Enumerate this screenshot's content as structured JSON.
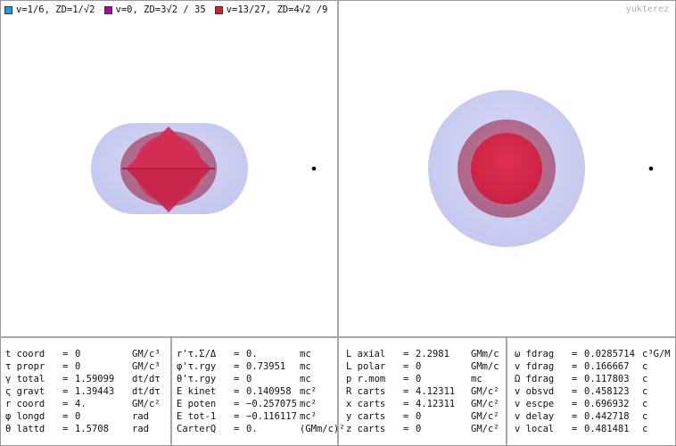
{
  "legend": [
    {
      "label": "v=1/6, ZD=1/√2",
      "color": "#1aa0e0"
    },
    {
      "label": "v=0, ZD=3√2 / 35",
      "color": "#b000b0"
    },
    {
      "label": "v=13/27, ZD=4√2 /9",
      "color": "#e01a2a"
    }
  ],
  "watermark": "yukterez",
  "colors": {
    "outer_shell": "#c9cbf2",
    "middle_shell": "#b96b8a",
    "core": "#d8284c",
    "separator": "#a8a8a8"
  },
  "panels": [
    {
      "rows": [
        {
          "name": "t coord",
          "eq": "=",
          "value": "0",
          "unit": "GM/c³"
        },
        {
          "name": "τ propr",
          "eq": "=",
          "value": "0",
          "unit": "GM/c³"
        },
        {
          "name": "γ total",
          "eq": "=",
          "value": "1.59099",
          "unit": "dt/dτ"
        },
        {
          "name": "ς gravt",
          "eq": "=",
          "value": "1.39443",
          "unit": "dt/dτ"
        },
        {
          "name": "r coord",
          "eq": "=",
          "value": "4.",
          "unit": "GM/c²"
        },
        {
          "name": "φ longd",
          "eq": "=",
          "value": "0",
          "unit": "rad"
        },
        {
          "name": "θ lattd",
          "eq": "=",
          "value": "1.5708",
          "unit": "rad"
        }
      ]
    },
    {
      "rows": [
        {
          "name": "r'τ.Σ/Δ",
          "eq": "=",
          "value": "0.",
          "unit": "mc"
        },
        {
          "name": "φ'τ.rgy",
          "eq": "=",
          "value": "0.73951",
          "unit": "mc"
        },
        {
          "name": "θ'τ.rgy",
          "eq": "=",
          "value": "0",
          "unit": "mc"
        },
        {
          "name": "E kinet",
          "eq": "=",
          "value": "0.140958",
          "unit": "mc²"
        },
        {
          "name": "E poten",
          "eq": "=",
          "value": "−0.257075",
          "unit": "mc²"
        },
        {
          "name": "E tot-1",
          "eq": "=",
          "value": "−0.116117",
          "unit": "mc²"
        },
        {
          "name": "CarterQ",
          "eq": "=",
          "value": "0.",
          "unit": "(GMm/c)²"
        }
      ]
    },
    {
      "rows": [
        {
          "name": "L axial",
          "eq": "=",
          "value": "2.2981",
          "unit": "GMm/c"
        },
        {
          "name": "L polar",
          "eq": "=",
          "value": "0",
          "unit": "GMm/c"
        },
        {
          "name": "p r.mom",
          "eq": "=",
          "value": "0",
          "unit": "mc"
        },
        {
          "name": "R carts",
          "eq": "=",
          "value": "4.12311",
          "unit": "GM/c²"
        },
        {
          "name": "x carts",
          "eq": "=",
          "value": "4.12311",
          "unit": "GM/c²"
        },
        {
          "name": "y carts",
          "eq": "=",
          "value": "0",
          "unit": "GM/c²"
        },
        {
          "name": "z carts",
          "eq": "=",
          "value": "0",
          "unit": "GM/c²"
        }
      ]
    },
    {
      "rows": [
        {
          "name": "ω fdrag",
          "eq": "=",
          "value": "0.0285714",
          "unit": "c³G/M"
        },
        {
          "name": "v fdrag",
          "eq": "=",
          "value": "0.166667",
          "unit": "c"
        },
        {
          "name": "Ω fdrag",
          "eq": "=",
          "value": "0.117803",
          "unit": "c"
        },
        {
          "name": "v obsvd",
          "eq": "=",
          "value": "0.458123",
          "unit": "c"
        },
        {
          "name": "v escpe",
          "eq": "=",
          "value": "0.696932",
          "unit": "c"
        },
        {
          "name": "v delay",
          "eq": "=",
          "value": "0.442718",
          "unit": "c"
        },
        {
          "name": "v local",
          "eq": "=",
          "value": "0.481481",
          "unit": "c"
        }
      ]
    }
  ]
}
